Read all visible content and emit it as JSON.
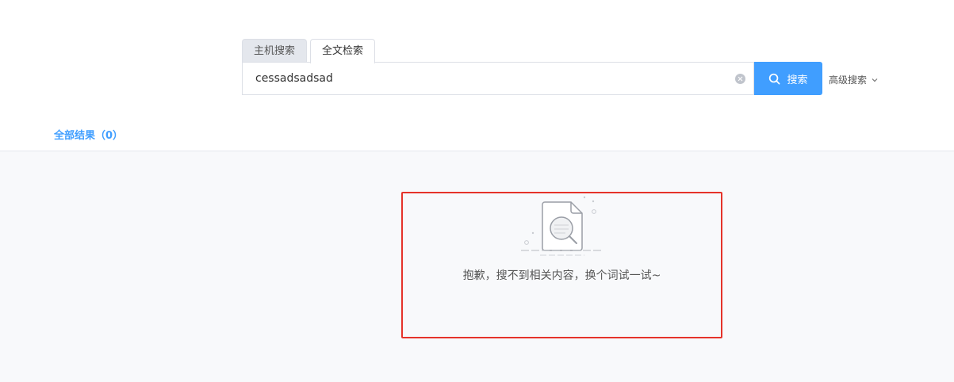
{
  "tabs": [
    {
      "label": "主机搜索",
      "active": false
    },
    {
      "label": "全文检索",
      "active": true
    }
  ],
  "search": {
    "value": "cessadsadsad",
    "button_label": "搜索"
  },
  "advanced_label": "高级搜索",
  "results": {
    "count_label": "全部结果（0）"
  },
  "empty": {
    "message": "抱歉，搜不到相关内容，换个词试一试~"
  },
  "colors": {
    "primary": "#409eff",
    "highlight_border": "#e5332a",
    "content_bg": "#f8f9fb"
  },
  "icons": {
    "search_button": "search-icon",
    "clear": "clear-icon",
    "advanced": "chevron-down-icon",
    "empty": "document-search-icon"
  }
}
